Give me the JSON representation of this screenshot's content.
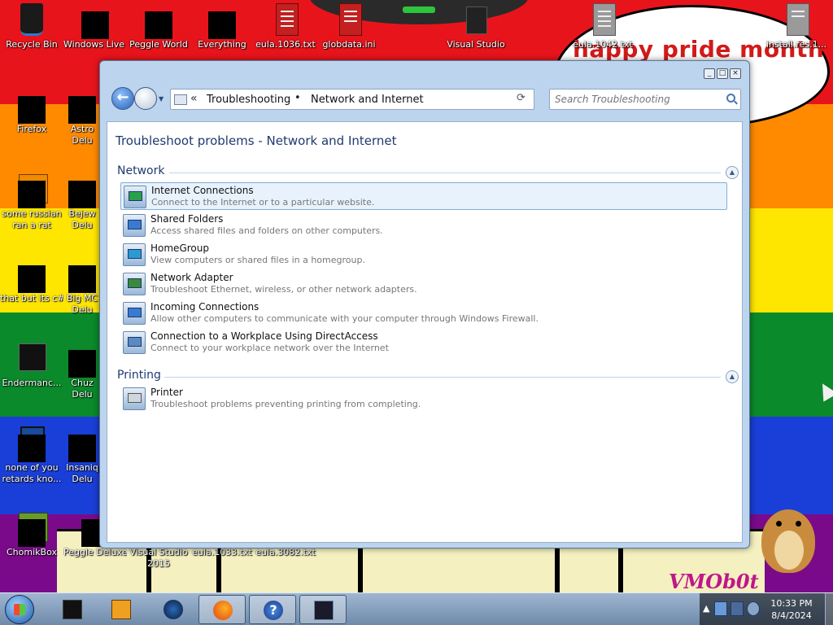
{
  "desktop": {
    "banner_text": "happy pride month",
    "watermark": "VMOb0t",
    "icons": [
      {
        "label": "Recycle Bin"
      },
      {
        "label": "Windows Live Ma"
      },
      {
        "label": "Peggle World"
      },
      {
        "label": "Everything"
      },
      {
        "label": "eula.1036.txt"
      },
      {
        "label": "globdata.ini"
      },
      {
        "label": "Visual Studio"
      },
      {
        "label": "eula.1042.txt"
      },
      {
        "label": "install.res.1..."
      },
      {
        "label": "Firefox"
      },
      {
        "label": "Astro Delu"
      },
      {
        "label": "some russian ran a rat"
      },
      {
        "label": "Bejew Delu"
      },
      {
        "label": "that but its c#"
      },
      {
        "label": "Big MC Delu"
      },
      {
        "label": "Endermanc..."
      },
      {
        "label": "Chuz Delu"
      },
      {
        "label": "none of you retards kno..."
      },
      {
        "label": "Insaniq Delu"
      },
      {
        "label": "ChomikBox"
      },
      {
        "label": "Peggle Deluxe"
      },
      {
        "label": "Visual Studio 2015"
      },
      {
        "label": "eula.1033.txt"
      },
      {
        "label": "eula.3082.txt"
      }
    ]
  },
  "window": {
    "breadcrumb": [
      "Troubleshooting",
      "Network and Internet"
    ],
    "breadcrumb_separator": "•",
    "search_placeholder": "Search Troubleshooting",
    "page_title": "Troubleshoot problems - Network and Internet",
    "groups": [
      {
        "name": "Network",
        "items": [
          {
            "title": "Internet Connections",
            "desc": "Connect to the Internet or to a particular website."
          },
          {
            "title": "Shared Folders",
            "desc": "Access shared files and folders on other computers."
          },
          {
            "title": "HomeGroup",
            "desc": "View computers or shared files in a homegroup."
          },
          {
            "title": "Network Adapter",
            "desc": "Troubleshoot Ethernet, wireless, or other network adapters."
          },
          {
            "title": "Incoming Connections",
            "desc": "Allow other computers to communicate with your computer through Windows Firewall."
          },
          {
            "title": "Connection to a Workplace Using DirectAccess",
            "desc": "Connect to your workplace network over the Internet"
          }
        ]
      },
      {
        "name": "Printing",
        "items": [
          {
            "title": "Printer",
            "desc": "Troubleshoot problems preventing printing from completing."
          }
        ]
      }
    ]
  },
  "taskbar": {
    "clock_time": "10:33 PM",
    "clock_date": "8/4/2024"
  },
  "colors": {
    "accent": "#1e3a6e",
    "selection": "#e8f2fc"
  }
}
